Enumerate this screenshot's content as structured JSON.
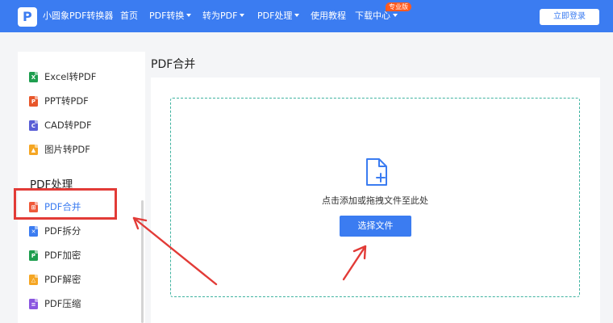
{
  "header": {
    "logo_letter": "P",
    "brand": "小圆象PDF转换器",
    "nav": [
      {
        "label": "首页",
        "dropdown": false
      },
      {
        "label": "PDF转换",
        "dropdown": true
      },
      {
        "label": "转为PDF",
        "dropdown": true
      },
      {
        "label": "PDF处理",
        "dropdown": true
      },
      {
        "label": "使用教程",
        "dropdown": false
      },
      {
        "label": "下载中心",
        "dropdown": true
      }
    ],
    "badge": "专业版",
    "login_label": "立即登录"
  },
  "sidebar": {
    "items": [
      {
        "label": "Excel转PDF",
        "icon": "excel-file-icon",
        "glyph": "X",
        "color": "#1e9e4f"
      },
      {
        "label": "PPT转PDF",
        "icon": "ppt-file-icon",
        "glyph": "P",
        "color": "#e8572b"
      },
      {
        "label": "CAD转PDF",
        "icon": "cad-file-icon",
        "glyph": "C",
        "color": "#5a5fd6"
      },
      {
        "label": "图片转PDF",
        "icon": "image-file-icon",
        "glyph": "▲",
        "color": "#f5a623"
      }
    ],
    "section_title": "PDF处理",
    "tools": [
      {
        "label": "PDF合并",
        "icon": "merge-icon",
        "glyph": "⊞",
        "color": "#ef5a3a"
      },
      {
        "label": "PDF拆分",
        "icon": "split-icon",
        "glyph": "✕",
        "color": "#3b7cf1"
      },
      {
        "label": "PDF加密",
        "icon": "lock-icon",
        "glyph": "P",
        "color": "#1e9e4f"
      },
      {
        "label": "PDF解密",
        "icon": "unlock-icon",
        "glyph": "△",
        "color": "#f5a623"
      },
      {
        "label": "PDF压缩",
        "icon": "compress-icon",
        "glyph": "≡",
        "color": "#8a56e0"
      }
    ]
  },
  "main": {
    "title": "PDF合并",
    "hint": "点击添加或拖拽文件至此处",
    "button_label": "选择文件"
  },
  "colors": {
    "accent": "#3b7cf1",
    "highlight": "#e23b37",
    "dashed_border": "#3fb3a0"
  }
}
